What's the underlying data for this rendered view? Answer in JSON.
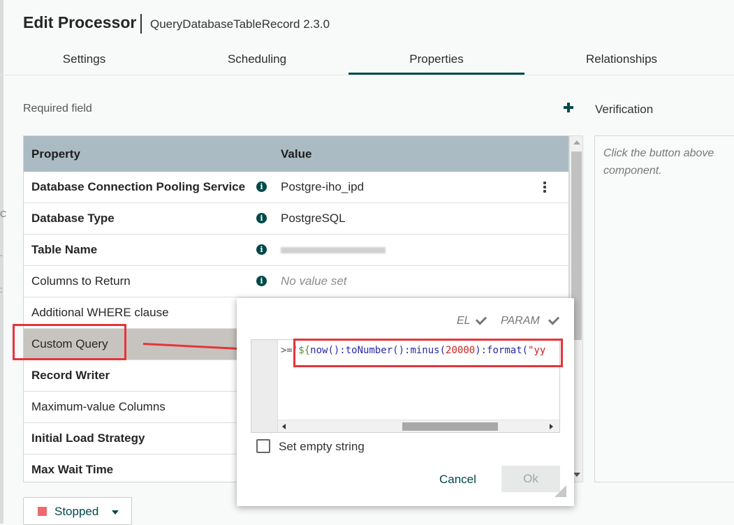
{
  "header": {
    "title": "Edit Processor",
    "subtitle": "QueryDatabaseTableRecord 2.3.0"
  },
  "tabs": [
    {
      "label": "Settings"
    },
    {
      "label": "Scheduling"
    },
    {
      "label": "Properties",
      "active": true
    },
    {
      "label": "Relationships"
    }
  ],
  "properties": {
    "required_label": "Required field",
    "add_icon": "plus-icon",
    "columns": {
      "property": "Property",
      "value": "Value"
    },
    "rows": [
      {
        "name": "Database Connection Pooling Service",
        "bold": true,
        "value": "Postgre-iho_ipd"
      },
      {
        "name": "Database Type",
        "bold": true,
        "value": "PostgreSQL"
      },
      {
        "name": "Table Name",
        "bold": true,
        "value": ""
      },
      {
        "name": "Columns to Return",
        "bold": false,
        "value": "No value set"
      },
      {
        "name": "Additional WHERE clause",
        "bold": false,
        "value": ""
      },
      {
        "name": "Custom Query",
        "bold": false,
        "value": "",
        "selected": true
      },
      {
        "name": "Record Writer",
        "bold": true,
        "value": ""
      },
      {
        "name": "Maximum-value Columns",
        "bold": false,
        "value": ""
      },
      {
        "name": "Initial Load Strategy",
        "bold": true,
        "value": ""
      },
      {
        "name": "Max Wait Time",
        "bold": true,
        "value": ""
      }
    ]
  },
  "verification": {
    "title": "Verification",
    "text": "Click the button above\ncomponent."
  },
  "editor_popup": {
    "el_label": "EL",
    "param_label": "PARAM",
    "code": {
      "op": ">=",
      "q": "'",
      "dollar": "${",
      "fn1": "now():toNumber():minus(",
      "num": "20000",
      "fn2": "):format(",
      "str": "\"yy"
    },
    "set_empty_label": "Set empty string",
    "cancel_label": "Cancel",
    "ok_label": "Ok"
  },
  "status": {
    "label": "Stopped",
    "color": "#ec6a6e"
  },
  "colors": {
    "accent": "#004849",
    "annotation": "#e8333a",
    "header_bg": "#aabbc3"
  }
}
